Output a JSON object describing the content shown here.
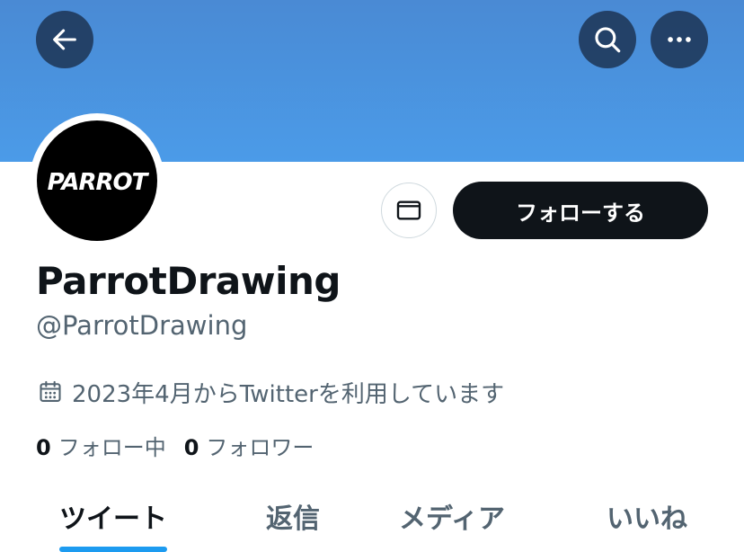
{
  "header": {
    "back_icon": "arrow-left-icon",
    "search_icon": "search-icon",
    "more_icon": "more-horizontal-icon",
    "banner_color": "#4a90e2"
  },
  "profile": {
    "avatar_logo_text": "PARROT",
    "display_name": "ParrotDrawing",
    "handle": "@ParrotDrawing",
    "joined": "2023年4月からTwitterを利用しています",
    "joined_icon": "calendar-icon",
    "message_icon": "mail-icon",
    "follow_label": "フォローする"
  },
  "stats": {
    "following_count": "0",
    "following_label": "フォロー中",
    "followers_count": "0",
    "followers_label": "フォロワー"
  },
  "tabs": [
    {
      "label": "ツイート",
      "active": true
    },
    {
      "label": "返信",
      "active": false
    },
    {
      "label": "メディア",
      "active": false
    },
    {
      "label": "いいね",
      "active": false
    }
  ],
  "colors": {
    "accent": "#1d9bf0",
    "primary_text": "#0f1419",
    "secondary_text": "#536471",
    "follow_button": "#0f1419"
  }
}
